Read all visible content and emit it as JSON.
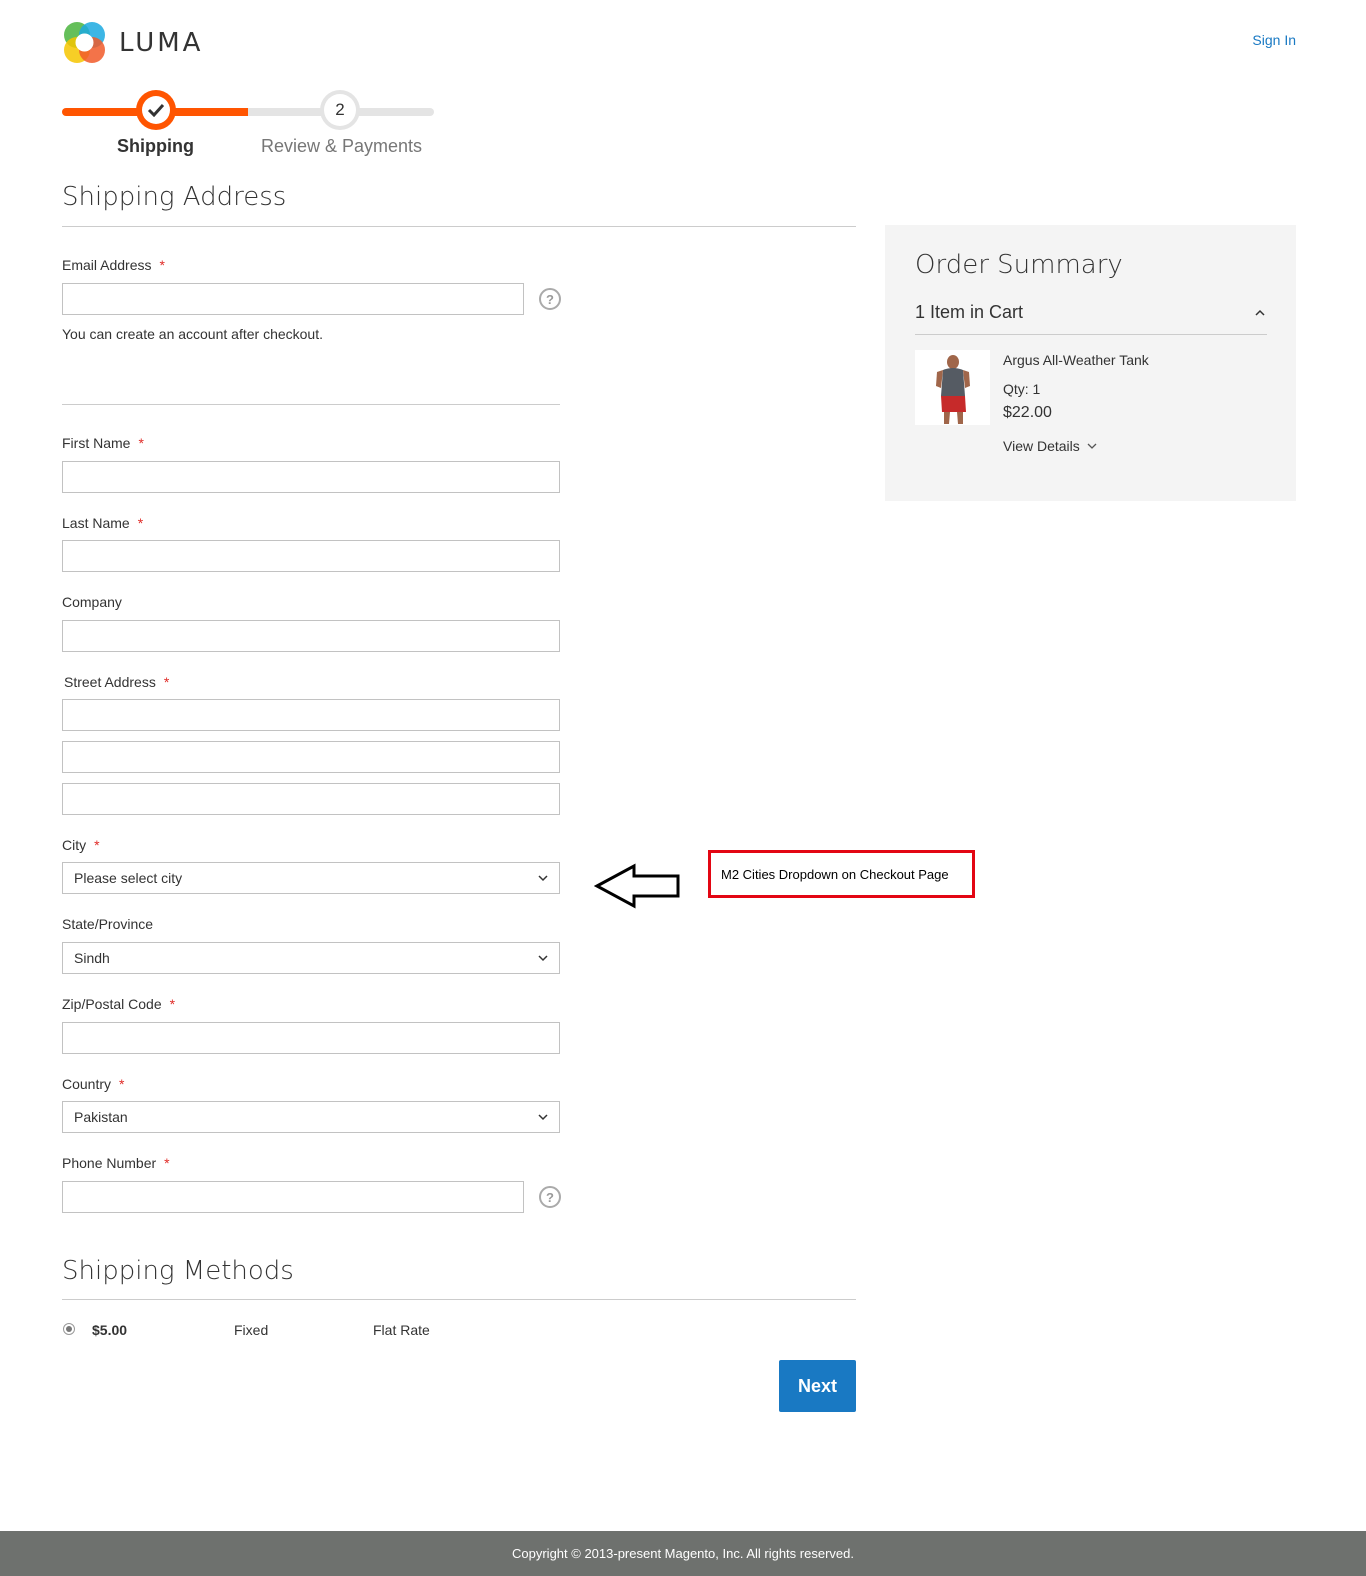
{
  "header": {
    "logo_text": "LUMA",
    "signin_label": "Sign In"
  },
  "progress": {
    "step1_label": "Shipping",
    "step2_number": "2",
    "step2_label": "Review & Payments"
  },
  "shipping_address": {
    "title": "Shipping Address",
    "email_label": "Email Address",
    "email_note": "You can create an account after checkout.",
    "first_name_label": "First Name",
    "last_name_label": "Last Name",
    "company_label": "Company",
    "street_label": "Street Address",
    "city_label": "City",
    "city_value": "Please select city",
    "state_label": "State/Province",
    "state_value": "Sindh",
    "zip_label": "Zip/Postal Code",
    "country_label": "Country",
    "country_value": "Pakistan",
    "phone_label": "Phone Number",
    "required_mark": "*",
    "help_mark": "?"
  },
  "shipping_methods": {
    "title": "Shipping Methods",
    "price": "$5.00",
    "method": "Fixed",
    "carrier": "Flat Rate",
    "next_label": "Next"
  },
  "order_summary": {
    "title": "Order Summary",
    "items_in_cart": "1 Item in Cart",
    "product_name": "Argus All-Weather Tank",
    "qty": "Qty: 1",
    "price": "$22.00",
    "view_details": "View Details"
  },
  "annotation": {
    "callout_text": "M2 Cities Dropdown on Checkout Page"
  },
  "footer": {
    "copyright": "Copyright © 2013-present Magento, Inc. All rights reserved."
  },
  "colors": {
    "accent_orange": "#ff5501",
    "link_blue": "#1979c3",
    "required_red": "#e02b27",
    "callout_red": "#e30613"
  }
}
